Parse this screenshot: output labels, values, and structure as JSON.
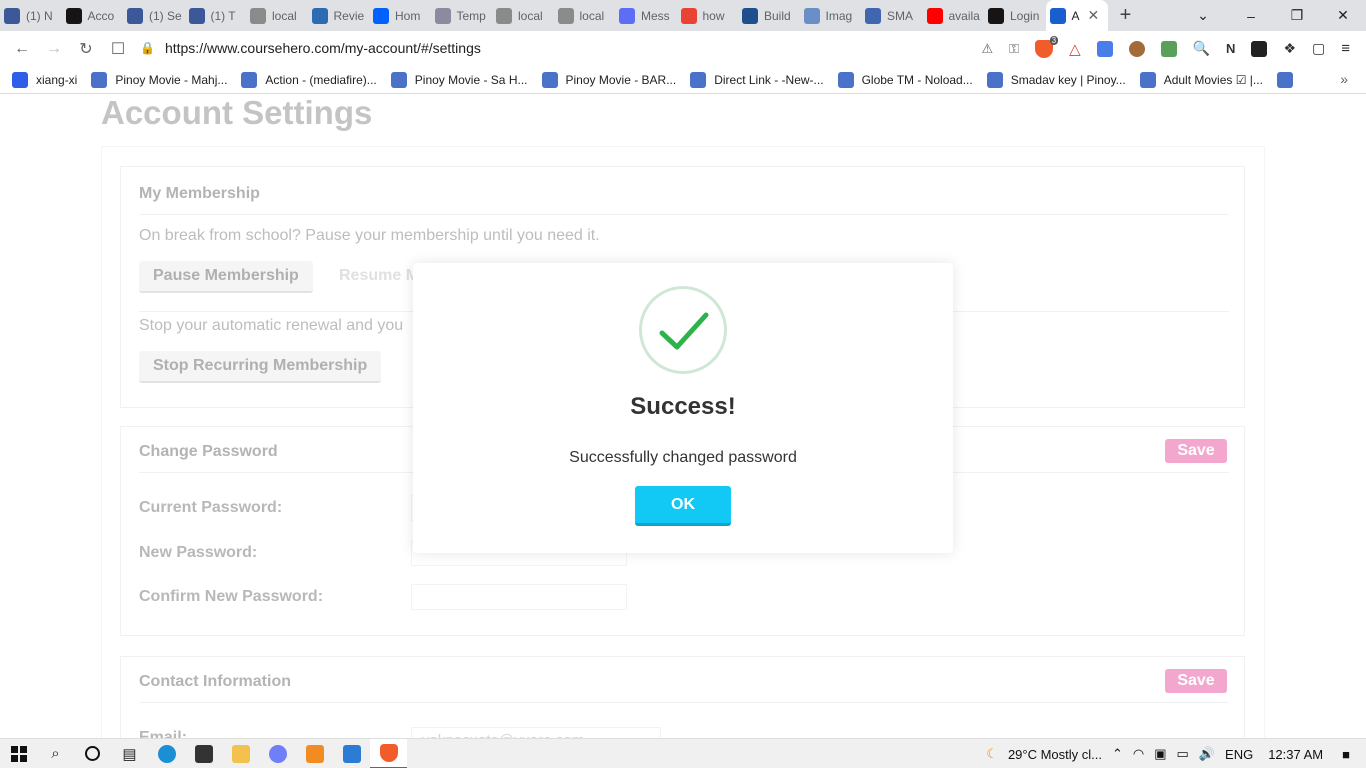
{
  "browser": {
    "tabs": [
      {
        "title": "(1) N",
        "color": "#3b5998"
      },
      {
        "title": "Acco",
        "color": "#191414"
      },
      {
        "title": "(1) Se",
        "color": "#3b5998"
      },
      {
        "title": "(1) T",
        "color": "#3b5998"
      },
      {
        "title": "local",
        "color": "#8a8a8a"
      },
      {
        "title": "Revie",
        "color": "#2d6cb5"
      },
      {
        "title": "Hom",
        "color": "#0061fe"
      },
      {
        "title": "Temp",
        "color": "#8a8aa0"
      },
      {
        "title": "local",
        "color": "#8a8a8a"
      },
      {
        "title": "local",
        "color": "#8a8a8a"
      },
      {
        "title": "Mess",
        "color": "#5b6ef5"
      },
      {
        "title": "how",
        "color": "#ea4335"
      },
      {
        "title": "Build",
        "color": "#1f4e8c"
      },
      {
        "title": "Imag",
        "color": "#6a8fc7"
      },
      {
        "title": "SMA",
        "color": "#4166b0"
      },
      {
        "title": "availa",
        "color": "#ff0000"
      },
      {
        "title": "Login",
        "color": "#191414"
      }
    ],
    "active_tab": {
      "title": "A",
      "color": "#1a5fd0"
    },
    "new_tab_label": "+",
    "url": "https://www.coursehero.com/my-account/#/settings",
    "bookmarks": [
      {
        "label": "xiang-xi",
        "color": "#2f5ee8"
      },
      {
        "label": "Pinoy Movie - Mahj...",
        "color": "#4a72c9"
      },
      {
        "label": "Action - (mediafire)...",
        "color": "#4a72c9"
      },
      {
        "label": "Pinoy Movie - Sa H...",
        "color": "#4a72c9"
      },
      {
        "label": "Pinoy Movie - BAR...",
        "color": "#4a72c9"
      },
      {
        "label": "Direct Link - -New-...",
        "color": "#4a72c9"
      },
      {
        "label": "Globe TM - Noload...",
        "color": "#4a72c9"
      },
      {
        "label": "Smadav key | Pinoy...",
        "color": "#4a72c9"
      },
      {
        "label": "Adult Movies ☑ |...",
        "color": "#4a72c9"
      },
      {
        "label": "",
        "color": "#4a72c9"
      }
    ],
    "bookmarks_more": "»",
    "extension_badge": "3"
  },
  "page": {
    "title": "Account Settings",
    "membership": {
      "heading": "My Membership",
      "pause_text": "On break from school? Pause your membership until you need it.",
      "pause_button": "Pause Membership",
      "resume_button": "Resume M",
      "stop_text": "Stop your automatic renewal and you",
      "stop_button": "Stop Recurring Membership"
    },
    "password": {
      "heading": "Change Password",
      "save": "Save",
      "current_label": "Current Password:",
      "new_label": "New Password:",
      "confirm_label": "Confirm New Password:"
    },
    "contact": {
      "heading": "Contact Information",
      "save": "Save",
      "email_label": "Email:",
      "email_value": "yaknocuato@yuere.com"
    }
  },
  "modal": {
    "title": "Success!",
    "message": "Successfully changed password",
    "ok": "OK",
    "check_color": "#2db34a"
  },
  "taskbar": {
    "weather": "29°C  Mostly cl...",
    "lang": "ENG",
    "time": "12:37 AM"
  }
}
